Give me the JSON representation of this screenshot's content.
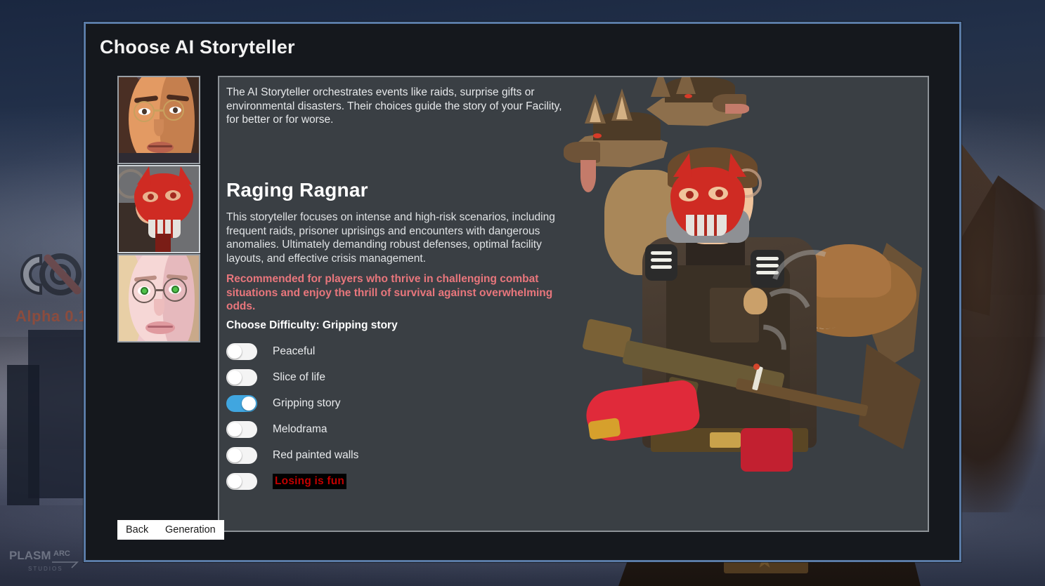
{
  "background": {
    "game_logo_name": "game-logo",
    "alpha_version": "Alpha 0.1",
    "studio_watermark": "PLASMARC"
  },
  "dialog": {
    "title": "Choose AI Storyteller"
  },
  "portraits": [
    {
      "name": "storyteller-portrait-1",
      "selected": false,
      "alt": "tan-skinned woman with round glasses"
    },
    {
      "name": "storyteller-portrait-2",
      "selected": true,
      "alt": "red skull-masked figure"
    },
    {
      "name": "storyteller-portrait-3",
      "selected": false,
      "alt": "pale woman with green eyes and glasses"
    }
  ],
  "panel": {
    "intro": "The AI Storyteller orchestrates events like raids, surprise gifts or environmental disasters. Their choices guide the story of your Facility, for better or for worse.",
    "storyteller_name": "Raging Ragnar",
    "storyteller_description": "This storyteller focuses on intense and high-risk scenarios, including frequent raids, prisoner uprisings and encounters with dangerous anomalies. Ultimately demanding robust defenses, optimal facility layouts, and effective crisis management.",
    "recommendation": "Recommended for players who thrive in challenging combat situations and enjoy the thrill of survival against overwhelming odds.",
    "difficulty_label": "Choose Difficulty: Gripping story",
    "selected_difficulty": "Gripping story"
  },
  "difficulties": [
    {
      "label": "Peaceful",
      "on": false,
      "danger": false
    },
    {
      "label": "Slice of life",
      "on": false,
      "danger": false
    },
    {
      "label": "Gripping story",
      "on": true,
      "danger": false
    },
    {
      "label": "Melodrama",
      "on": false,
      "danger": false
    },
    {
      "label": "Red painted walls",
      "on": false,
      "danger": false
    },
    {
      "label": "Losing is fun",
      "on": false,
      "danger": true
    }
  ],
  "character_art": {
    "name": "raging-ragnar-artwork",
    "alt": "masked soldier with red skull mask, wolves, cowboy hat and rifle"
  },
  "buttons": {
    "back": "Back",
    "generation": "Generation"
  },
  "colors": {
    "dialog_border": "#5a7ba6",
    "dialog_bg": "#15181d",
    "panel_bg": "#3a3f44",
    "panel_border": "#8e9398",
    "toggle_on": "#40a6e0",
    "toggle_off": "#f4f4f4",
    "recommendation_text": "#e8767c",
    "danger_text": "#c20000",
    "danger_bg": "#000000"
  }
}
